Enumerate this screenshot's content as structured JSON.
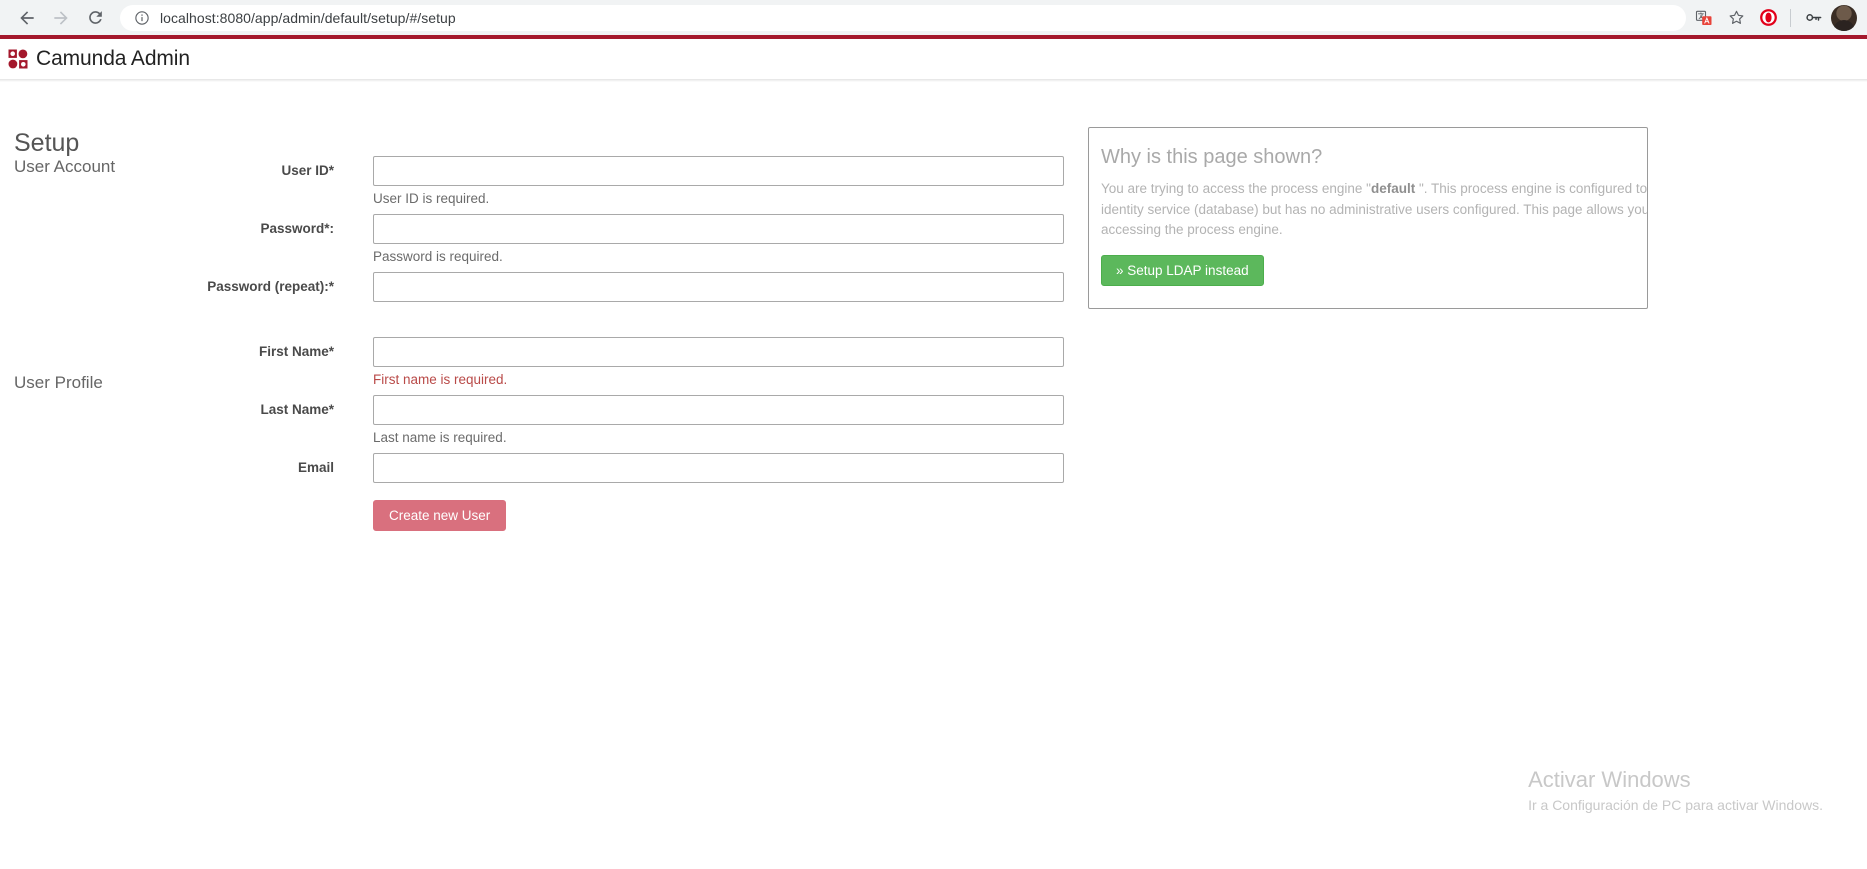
{
  "browser": {
    "back_label": "Back",
    "forward_label": "Forward",
    "reload_label": "Reload",
    "url_prefix": "localhost:8080",
    "url_path": "/app/admin/default/setup/#/setup",
    "url_full": "localhost:8080/app/admin/default/setup/#/setup",
    "icons": {
      "back": "back-arrow-icon",
      "forward": "forward-arrow-icon",
      "reload": "reload-icon",
      "site_info": "info-circle-icon",
      "translate": "translate-icon",
      "bookmark": "star-icon",
      "extension": "opera-shield-icon",
      "password": "key-icon",
      "profile": "avatar-icon"
    }
  },
  "app": {
    "title": "Camunda Admin",
    "brand_color": "#a4182c",
    "logo_name": "camunda-logo"
  },
  "page": {
    "title": "Setup",
    "sections": {
      "account_heading": "User Account",
      "profile_heading": "User Profile"
    },
    "fields": [
      {
        "id": "userId",
        "label": "User ID*",
        "value": "",
        "placeholder": "",
        "help": "User ID is required.",
        "help_state": "muted",
        "type": "text"
      },
      {
        "id": "password",
        "label": "Password*:",
        "value": "",
        "placeholder": "",
        "help": "Password is required.",
        "help_state": "muted",
        "type": "password"
      },
      {
        "id": "passwordRepeat",
        "label": "Password (repeat):*",
        "value": "",
        "placeholder": "",
        "help": "",
        "help_state": "none",
        "type": "password"
      },
      {
        "id": "firstName",
        "label": "First Name*",
        "value": "",
        "placeholder": "",
        "help": "First name is required.",
        "help_state": "error",
        "type": "text"
      },
      {
        "id": "lastName",
        "label": "Last Name*",
        "value": "",
        "placeholder": "",
        "help": "Last name is required.",
        "help_state": "muted",
        "type": "text"
      },
      {
        "id": "email",
        "label": "Email",
        "value": "",
        "placeholder": "",
        "help": "",
        "help_state": "none",
        "type": "text"
      }
    ],
    "submit_label": "Create new User",
    "submit_color": "#d9707e"
  },
  "info_panel": {
    "title": "Why is this page shown?",
    "body_part1": "You are trying to access the process engine \"",
    "body_engine": "default",
    "body_part2": "\". This process engine is configured to use the built-in identity service (database) but has no administrative users configured. This page allows you to create a user for accessing the process engine.",
    "ldap_button_label": "» Setup LDAP instead",
    "ldap_button_color": "#5cb85c"
  },
  "watermark": {
    "line1": "Activar Windows",
    "line2": "Ir a Configuración de PC para activar Windows."
  }
}
